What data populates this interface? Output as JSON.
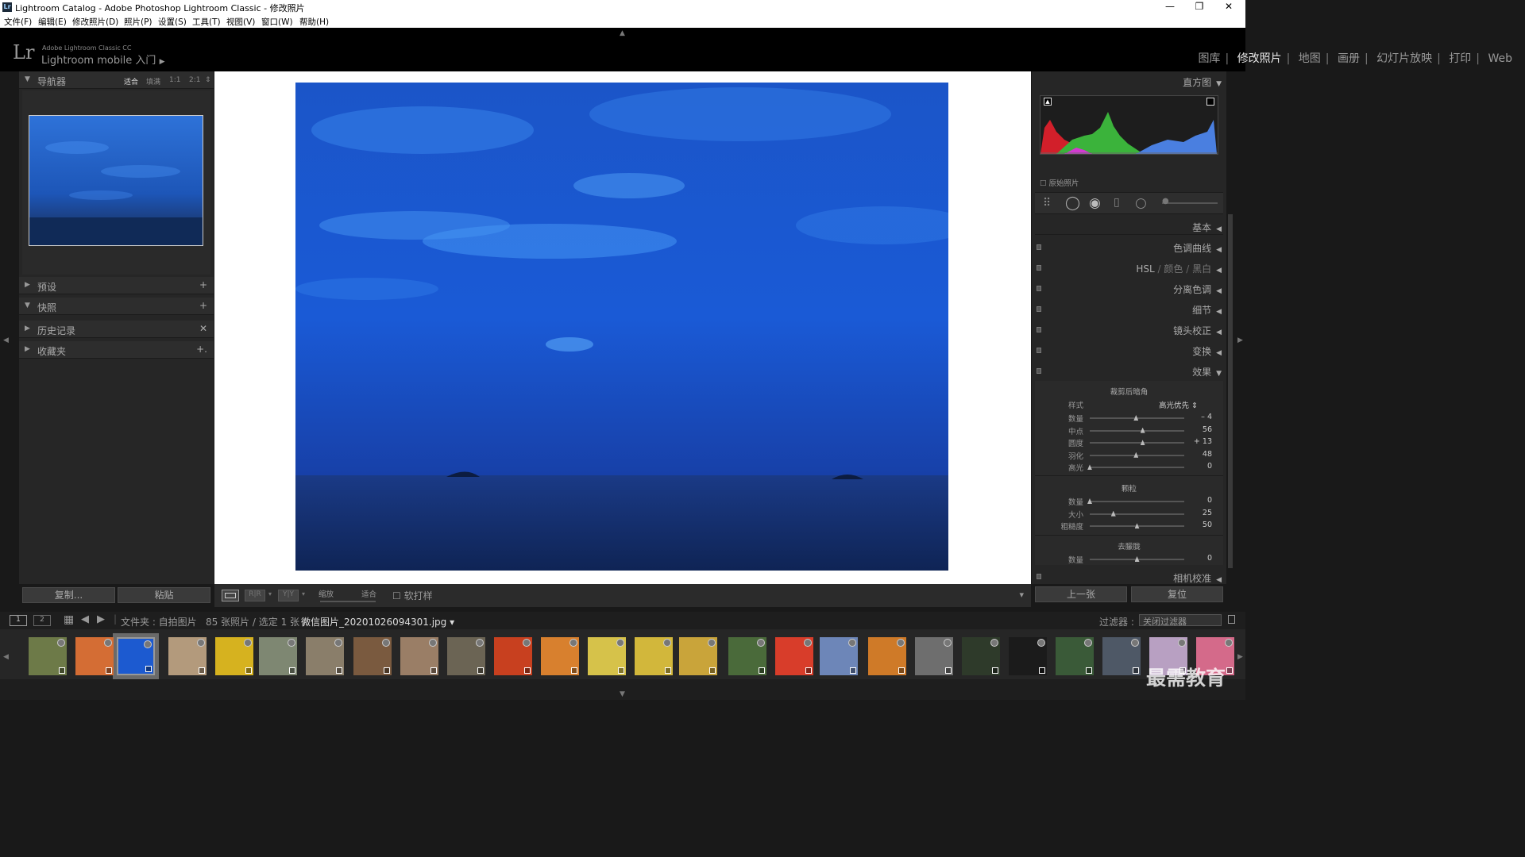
{
  "window": {
    "title": "Lightroom Catalog - Adobe Photoshop Lightroom Classic - 修改照片",
    "logo_glyph": "Lr",
    "min": "—",
    "max": "❐",
    "close": "✕"
  },
  "menu": [
    "文件(F)",
    "编辑(E)",
    "修改照片(D)",
    "照片(P)",
    "设置(S)",
    "工具(T)",
    "视图(V)",
    "窗口(W)",
    "帮助(H)"
  ],
  "brand": {
    "logo": "Lr",
    "line1": "Adobe Lightroom Classic CC",
    "line2": "Lightroom mobile 入门"
  },
  "modules": [
    "图库",
    "修改照片",
    "地图",
    "画册",
    "幻灯片放映",
    "打印",
    "Web"
  ],
  "active_module": "修改照片",
  "left": {
    "navigator": {
      "label": "导航器",
      "opts": [
        "适合",
        "填满",
        "1:1",
        "2:1"
      ]
    },
    "sections": [
      {
        "label": "预设",
        "action": "+"
      },
      {
        "label": "快照",
        "action": "+"
      },
      {
        "label": "历史记录",
        "action": "✕"
      },
      {
        "label": "收藏夹",
        "action": "+."
      }
    ],
    "copy": "复制...",
    "paste": "粘贴"
  },
  "right": {
    "histogram": "直方图",
    "original": "原始照片",
    "panels": [
      "基本",
      "色调曲线",
      "HSL",
      "颜色",
      "黑白",
      "分离色调",
      "细节",
      "镜头校正",
      "变换",
      "效果"
    ],
    "vignette": {
      "title": "裁剪后暗角",
      "style_label": "样式",
      "style_value": "高光优先",
      "rows": [
        {
          "label": "数量",
          "value": "– 4",
          "pos": 0.49
        },
        {
          "label": "中点",
          "value": "56",
          "pos": 0.56
        },
        {
          "label": "圆度",
          "value": "+ 13",
          "pos": 0.56
        },
        {
          "label": "羽化",
          "value": "48",
          "pos": 0.49
        },
        {
          "label": "高光",
          "value": "0",
          "pos": 0.0
        }
      ]
    },
    "grain": {
      "title": "颗粒",
      "rows": [
        {
          "label": "数量",
          "value": "0",
          "pos": 0.0
        },
        {
          "label": "大小",
          "value": "25",
          "pos": 0.25
        },
        {
          "label": "粗糙度",
          "value": "50",
          "pos": 0.5
        }
      ]
    },
    "dehaze": {
      "title": "去朦胧",
      "rows": [
        {
          "label": "数量",
          "value": "0",
          "pos": 0.5
        }
      ]
    },
    "camera": "相机校准",
    "prev": "上一张",
    "reset": "复位"
  },
  "toolbar": {
    "zoom": "缩放",
    "fit": "适合",
    "softproof": "软打样"
  },
  "filmbar": {
    "pages": [
      "1",
      "2"
    ],
    "source": "文件夹 : 自拍图片",
    "count": "85 张照片 / 选定 1 张 /",
    "file": "微信图片_20201026094301.jpg",
    "filter_label": "过滤器 :",
    "filter_value": "关闭过滤器"
  },
  "watermark": "最需教育",
  "colors": {
    "accent": "#1650c4",
    "panel": "#262626",
    "bg": "#191919"
  },
  "thumbnails": [
    "forest",
    "sunset",
    "blue-sky",
    "temple",
    "yellow-flower",
    "pond",
    "village",
    "canal",
    "building",
    "bridge",
    "red-flower",
    "orange-flower",
    "yellow-petals",
    "yellow-bloom",
    "yellow-flowers",
    "tree",
    "red-lily",
    "city-sky",
    "orange-lily",
    "tree-sky",
    "white-flower",
    "white-blossom",
    "plant",
    "dusk",
    "lotus",
    "pink-flower"
  ]
}
